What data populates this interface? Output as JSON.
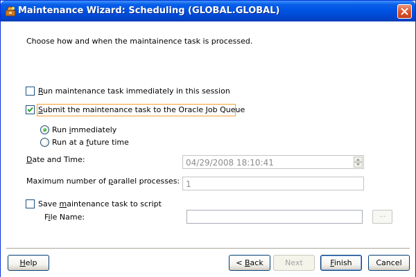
{
  "window": {
    "title": "Maintenance Wizard: Scheduling (GLOBAL.GLOBAL)"
  },
  "instruction": "Choose how and when the maintainence task is processed.",
  "options": {
    "run_immediately_session": {
      "mnemonic": "R",
      "rest": "un maintenance task immediately in this session",
      "checked": false
    },
    "submit_job_queue": {
      "mnemonic": "S",
      "rest": "ubmit the maintenance task to the Oracle Job Queue",
      "checked": true
    },
    "radio_immediately": {
      "before": "Run ",
      "mnemonic": "i",
      "after": "mmediately",
      "selected": true
    },
    "radio_future": {
      "before": "Run at a ",
      "mnemonic": "f",
      "after": "uture time",
      "selected": false
    }
  },
  "date_time": {
    "label_mnemonic": "D",
    "label_rest": "ate and Time:",
    "value": "04/29/2008 18:10:41"
  },
  "parallel": {
    "label_before": "Maximum number of ",
    "label_mnemonic": "p",
    "label_after": "arallel processes:",
    "value": "1"
  },
  "save_script": {
    "label_before": "Save ",
    "label_mnemonic": "m",
    "label_after": "aintenance task to script",
    "checked": false
  },
  "file_name": {
    "label_before": "F",
    "label_mnemonic": "i",
    "label_after": "le Name:",
    "value": "",
    "browse_label": "..."
  },
  "buttons": {
    "help": {
      "mnemonic": "H",
      "rest": "elp"
    },
    "back": {
      "prefix": "< ",
      "mnemonic": "B",
      "rest": "ack"
    },
    "next": "Next",
    "finish": {
      "mnemonic": "F",
      "rest": "inish"
    },
    "cancel": "Cancel"
  },
  "colors": {
    "titlebar": "#0054e3",
    "focus_frame": "#f0a030",
    "checkmark": "#21a121"
  }
}
